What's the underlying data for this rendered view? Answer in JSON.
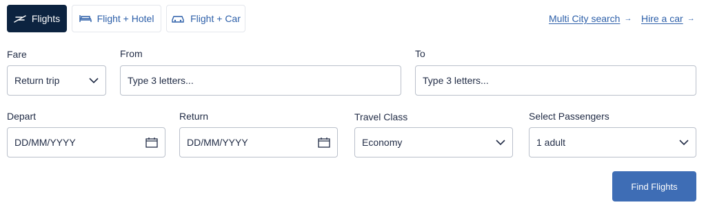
{
  "tabs": [
    {
      "label": "Flights",
      "icon": "plane-icon"
    },
    {
      "label": "Flight + Hotel",
      "icon": "bed-icon"
    },
    {
      "label": "Flight + Car",
      "icon": "car-icon"
    }
  ],
  "links": {
    "multi_city": "Multi City search",
    "hire_car": "Hire a car",
    "arrow": "→"
  },
  "form": {
    "fare": {
      "label": "Fare",
      "value": "Return trip"
    },
    "from": {
      "label": "From",
      "placeholder": "Type 3 letters..."
    },
    "to": {
      "label": "To",
      "placeholder": "Type 3 letters..."
    },
    "depart": {
      "label": "Depart",
      "placeholder": "DD/MM/YYYY"
    },
    "return": {
      "label": "Return",
      "placeholder": "DD/MM/YYYY"
    },
    "travel_class": {
      "label": "Travel Class",
      "value": "Economy"
    },
    "passengers": {
      "label": "Select Passengers",
      "value": "1 adult"
    }
  },
  "actions": {
    "find": "Find Flights"
  },
  "colors": {
    "navy": "#0c2340",
    "link_blue": "#2b5ea8",
    "button_blue": "#3e6db5",
    "border": "#b9bfca"
  }
}
